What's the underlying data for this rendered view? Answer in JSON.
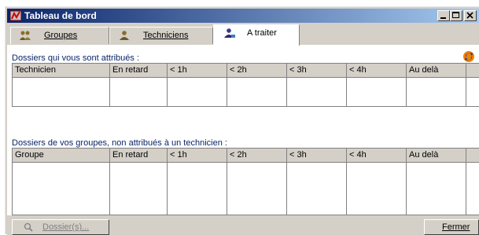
{
  "window": {
    "title": "Tableau de bord"
  },
  "tabs": [
    {
      "label": "Groupes",
      "icon": "group-icon",
      "active": false
    },
    {
      "label": "Techniciens",
      "icon": "technician-icon",
      "active": false
    },
    {
      "label": "A traiter",
      "icon": "to-do-icon",
      "active": true
    }
  ],
  "section1": {
    "title": "Dossiers qui vous sont attribués :",
    "columns": [
      "Technicien",
      "En retard",
      "< 1h",
      "< 2h",
      "< 3h",
      "< 4h",
      "Au delà"
    ]
  },
  "section2": {
    "title": "Dossiers de vos groupes, non attribués à un technicien :",
    "columns": [
      "Groupe",
      "En retard",
      "< 1h",
      "< 2h",
      "< 3h",
      "< 4h",
      "Au delà"
    ]
  },
  "buttons": {
    "dossiers": "Dossier(s)...",
    "fermer": "Fermer"
  },
  "colors": {
    "title_bar_start": "#0a246a",
    "title_bar_end": "#a6caf0",
    "section_title": "#0a246a",
    "refresh_icon": "#f08000"
  }
}
